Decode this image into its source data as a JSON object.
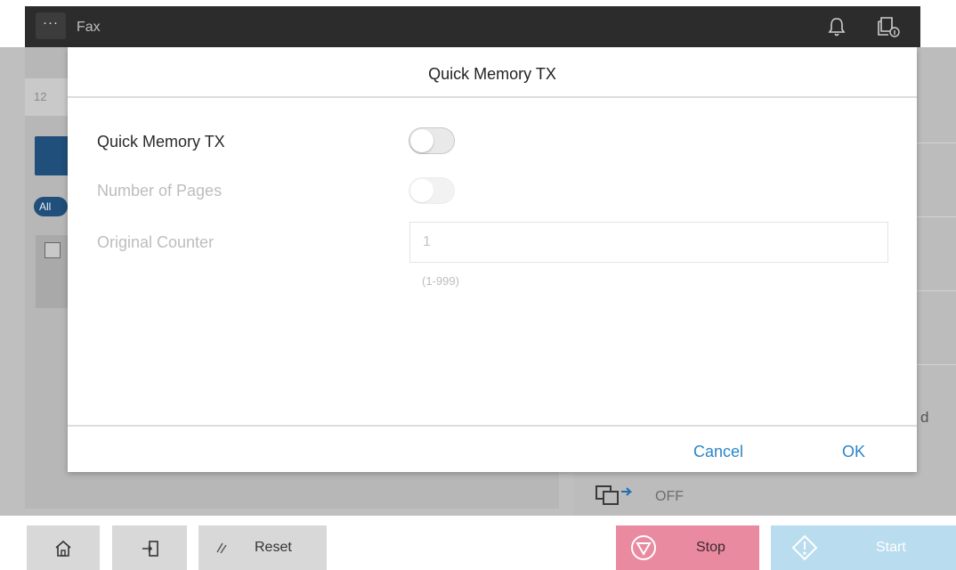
{
  "app": {
    "title": "Fax",
    "menu_icon": "ellipsis-icon",
    "notification_icon": "bell-icon",
    "job_icon": "job-info-icon"
  },
  "background": {
    "address_hint": "12",
    "filter_label": "All",
    "right_panel": {
      "truncated_label": "d",
      "quick_memory_value": "OFF"
    }
  },
  "dialog": {
    "title": "Quick Memory TX",
    "rows": [
      {
        "label": "Quick Memory TX",
        "control": "toggle",
        "state": "off",
        "enabled": true
      },
      {
        "label": "Number of Pages",
        "control": "toggle",
        "state": "off",
        "enabled": false
      },
      {
        "label": "Original Counter",
        "control": "input",
        "value": "1",
        "enabled": false
      }
    ],
    "counter_value": "1",
    "counter_range": "(1-999)",
    "cancel_label": "Cancel",
    "ok_label": "OK"
  },
  "bottom_bar": {
    "home_icon": "home-icon",
    "login_icon": "login-icon",
    "reset_label": "Reset",
    "stop_label": "Stop",
    "start_label": "Start"
  },
  "colors": {
    "accent": "#2a86c8",
    "stop": "#e98aa0",
    "start": "#b9dcef",
    "topbar": "#2c2c2c"
  }
}
